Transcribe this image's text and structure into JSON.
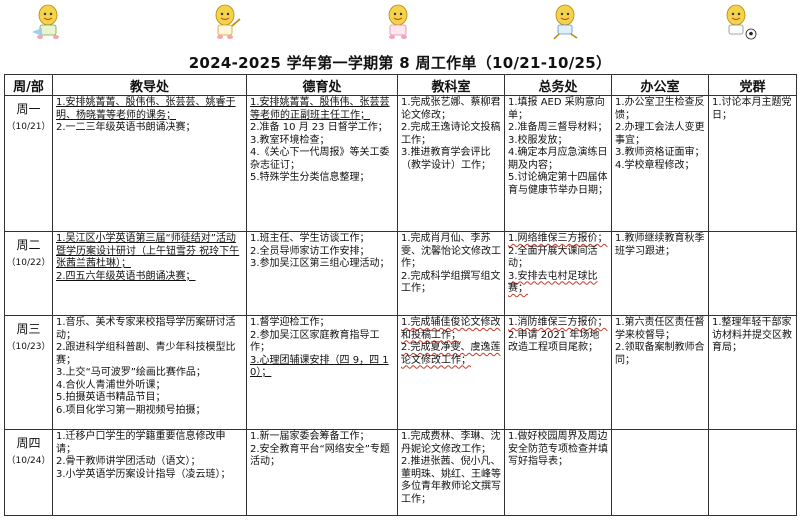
{
  "header": {
    "title": "2024-2025 学年第一学期第 8 周工作单（10/21-10/25）"
  },
  "columns": [
    "周/部",
    "教导处",
    "德育处",
    "教科室",
    "总务处",
    "办公室",
    "党群"
  ],
  "rows": [
    {
      "day": "周一",
      "date": "（10/21）",
      "cells": [
        [
          "1.安排姚菁菁、殷伟伟、张芸芸、姚睿于明、杨晓菁等老师的课务；",
          "2.一二三年级英语书朗诵决赛；"
        ],
        [
          "1.安排姚菁菁、殷伟伟、张芸芸等老师的正副班主任工作；",
          "2.准备 10 月 23 日督学工作；",
          "3.教室环境检查；",
          "4.《关心下一代周报》等关工委杂志征订；",
          "5.特殊学生分类信息整理；"
        ],
        [
          "1.完成张艺娜、蔡柳君论文修改；",
          "2.完成王逸诗论文投稿工作；",
          "3.推进教育学会评比（教学设计）工作；"
        ],
        [
          "1.填报 AED 采购意向单；",
          "2.准备周三督导材料；",
          "3.校服发放；",
          "4.确定本月应急演练日期及内容；",
          "5.讨论确定第十四届体育与健康节举办日期；"
        ],
        [
          "1.办公室卫生检查反馈；",
          "2.办理工会法人变更事宜；",
          "3.教师资格证面审；",
          "4.学校章程修改；"
        ],
        [
          "1.讨论本月主题党日；"
        ]
      ]
    },
    {
      "day": "周二",
      "date": "（10/22）",
      "cells": [
        [
          "1.吴江区小学英语第三届“师徒结对”活动暨学历案设计研讨（上午钮雪芬 祝玲下午张茜兰茜杜琳）；",
          "2.四五六年级英语书朗诵决赛；"
        ],
        [
          "1.班主任、学生访谈工作；",
          "2.全员导师家访工作安排；",
          "3.参加吴江区第三组心理活动；"
        ],
        [
          "1.完成肖月仙、李苏雯、沈馨怡论文修改工作；",
          "2.完成科学组撰写组文工作；"
        ],
        [
          "1.网络维保三方报价；",
          "2.全面开展大课间活动；",
          "3.安排去屯村足球比赛；"
        ],
        [
          "1.教师继续教育秋季班学习跟进；"
        ],
        [
          ""
        ]
      ]
    },
    {
      "day": "周三",
      "date": "（10/23）",
      "cells": [
        [
          "1.音乐、美术专家来校指导学历案研讨活动；",
          "2.跟进科学组科普剧、青少年科技模型比赛；",
          "3.上交“马可波罗”绘画比赛作品；",
          "4.合伙人青浦世外听课；",
          "5.拍摄英语书精品节目；",
          "6.项目化学习第一期视频号拍摄；"
        ],
        [
          "1.督学迎检工作；",
          "2.参加吴江区家庭教育指导工作；",
          "3.心理团辅课安排（四 9，四 10）；"
        ],
        [
          "1.完成辅佳俊论文修改和投稿工作；",
          "2.完成夏净雯、虞逸莲论文修改工作；"
        ],
        [
          "1.消防维保三方报价；",
          "2.申请 2021 年场地改造工程项目尾款；"
        ],
        [
          "1.第六责任区责任督学来校督导；",
          "2.领取备案制教师合同；"
        ],
        [
          "1.整理年轻干部家访材料并提交区教育局；"
        ]
      ]
    },
    {
      "day": "周四",
      "date": "（10/24）",
      "cells": [
        [
          "1.迁移户口学生的学籍重要信息修改申请；",
          "2.骨干教师讲学团活动（语文）；",
          "3.小学英语学历案设计指导（凌云琏）；"
        ],
        [
          "1.新一届家委会筹备工作；",
          "2.安全教育平台“网络安全”专题活动；"
        ],
        [
          "1.完成费林、李琳、沈丹妮论文修改工作；",
          "2.推进张茜、倪小凡、董明珠、姚红、王峰等多位青年教师论文撰写工作；"
        ],
        [
          "1.做好校园周界及周边安全防范专项检查并填写好指导表；"
        ],
        [
          ""
        ],
        [
          ""
        ]
      ]
    }
  ]
}
